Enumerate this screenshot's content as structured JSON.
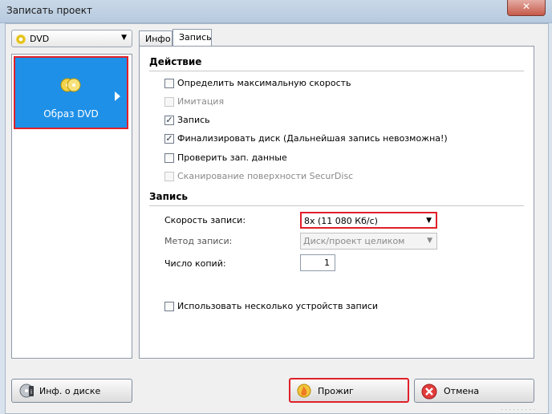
{
  "window": {
    "title": "Записать проект",
    "close_glyph": "✕"
  },
  "device_combo": {
    "value": "DVD",
    "arrow": "▼"
  },
  "left_panel": {
    "tile_label": "Образ DVD"
  },
  "tabs": [
    {
      "label": "Инфо"
    },
    {
      "label": "Запись"
    }
  ],
  "action": {
    "heading": "Действие",
    "items": [
      {
        "label": "Определить максимальную скорость",
        "checked": false,
        "enabled": true
      },
      {
        "label": "Имитация",
        "checked": false,
        "enabled": false
      },
      {
        "label": "Запись",
        "checked": true,
        "enabled": true
      },
      {
        "label": "Финализировать диск (Дальнейшая запись невозможна!)",
        "checked": true,
        "enabled": true
      },
      {
        "label": "Проверить зап. данные",
        "checked": false,
        "enabled": true
      },
      {
        "label": "Сканирование поверхности SecurDisc",
        "checked": false,
        "enabled": false
      }
    ]
  },
  "write": {
    "heading": "Запись",
    "speed_label": "Скорость записи:",
    "speed_value": "8x (11 080 Кб/с)",
    "method_label": "Метод записи:",
    "method_value": "Диск/проект целиком",
    "copies_label": "Число копий:",
    "copies_value": "1",
    "multi_device_label": "Использовать несколько устройств записи",
    "multi_device_checked": false
  },
  "buttons": {
    "disc_info": "Инф. о диске",
    "burn": "Прожиг",
    "cancel": "Отмена"
  },
  "colors": {
    "accent_blue": "#1e90e8",
    "highlight_red": "#e0202a"
  }
}
